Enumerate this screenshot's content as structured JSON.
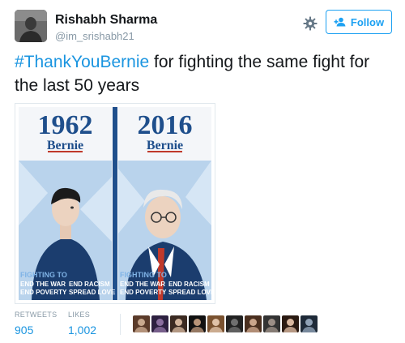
{
  "user": {
    "name": "Rishabh Sharma",
    "handle": "@im_srishabh21"
  },
  "actions": {
    "follow_label": "Follow"
  },
  "tweet": {
    "hashtag": "#ThankYouBernie",
    "text_rest": " for fighting the same fight for the last 50 years"
  },
  "image": {
    "left": {
      "year": "1962",
      "name": "Bernie",
      "heading": "FIGHTING TO",
      "line1_a": "END THE WAR",
      "line1_b": "END RACISM",
      "line2_a": "END POVERTY",
      "line2_b": "SPREAD LOVE"
    },
    "right": {
      "year": "2016",
      "name": "Bernie",
      "heading": "FIGHTING TO",
      "line1_a": "END THE WAR",
      "line1_b": "END RACISM",
      "line2_a": "END POVERTY",
      "line2_b": "SPREAD LOVE"
    }
  },
  "stats": {
    "retweets_label": "RETWEETS",
    "retweets_value": "905",
    "likes_label": "LIKES",
    "likes_value": "1,002"
  },
  "colors": {
    "accent": "#1da1f2",
    "link": "#1b95e0",
    "muted": "#8899a6",
    "poster_blue": "#1f4f8c",
    "poster_red": "#c0392b"
  },
  "likers": [
    "liker-1",
    "liker-2",
    "liker-3",
    "liker-4",
    "liker-5",
    "liker-6",
    "liker-7",
    "liker-8",
    "liker-9",
    "liker-10"
  ]
}
